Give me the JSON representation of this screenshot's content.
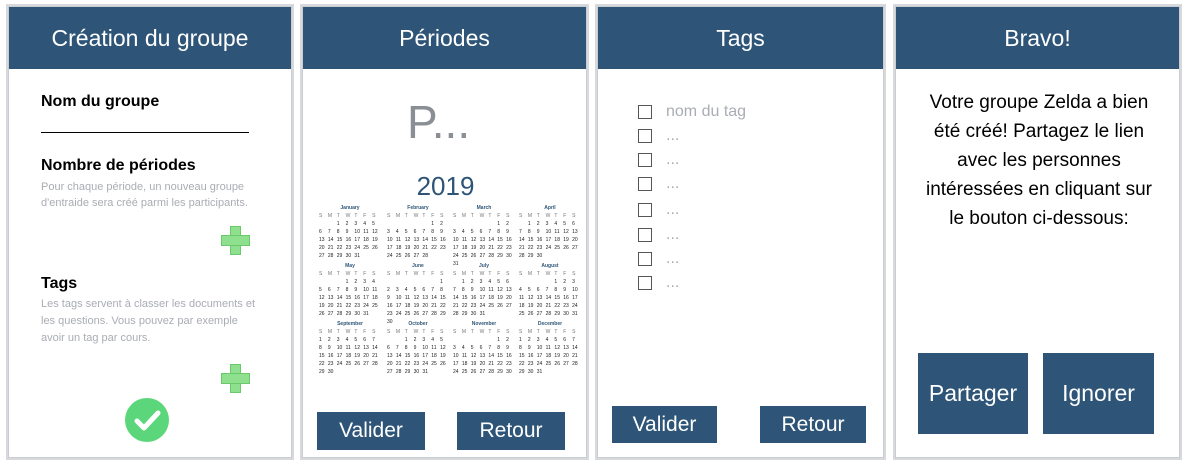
{
  "panel1": {
    "title": "Création du groupe",
    "group_name_label": "Nom du groupe",
    "periods_label": "Nombre de périodes",
    "periods_help": "Pour chaque période, un nouveau groupe d'entraide sera créé parmi les participants.",
    "tags_label": "Tags",
    "tags_help": "Les tags servent à classer les documents et les questions. Vous pouvez par exemple avoir un tag par cours.",
    "icons": [
      "plus-icon",
      "plus-icon",
      "checkmark-icon"
    ],
    "colors": {
      "plus": "#8ee08e",
      "confirm": "#5cd67a"
    }
  },
  "panel2": {
    "title": "Périodes",
    "placeholder": "P...",
    "year": "2019",
    "months": [
      "January",
      "February",
      "March",
      "April",
      "May",
      "June",
      "July",
      "August",
      "September",
      "October",
      "November",
      "December"
    ],
    "validate_label": "Valider",
    "back_label": "Retour"
  },
  "panel3": {
    "title": "Tags",
    "tags": [
      "nom du tag",
      "...",
      "...",
      "...",
      "...",
      "...",
      "...",
      "..."
    ],
    "validate_label": "Valider",
    "back_label": "Retour"
  },
  "panel4": {
    "title": "Bravo!",
    "message": "Votre groupe Zelda a bien été créé! Partagez le lien avec les personnes intéressées en cliquant sur le bouton ci-dessous:",
    "share_label": "Partager",
    "ignore_label": "Ignorer"
  },
  "theme": {
    "header": "#2e5577",
    "muted_text": "#a9adb3"
  }
}
